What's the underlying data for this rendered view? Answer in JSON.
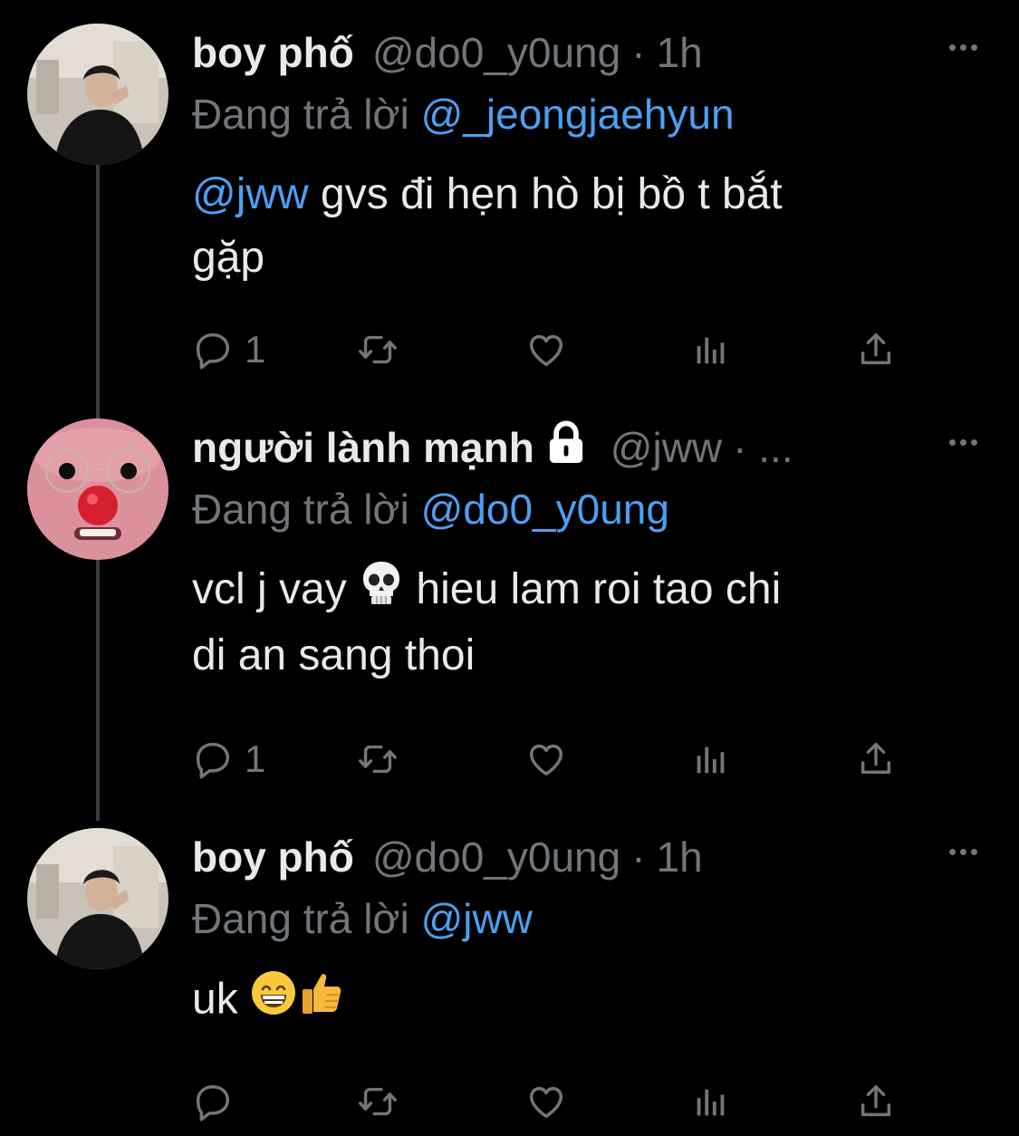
{
  "tweets": [
    {
      "name": "boy phố",
      "handle": "@do0_y0ung",
      "dot": "·",
      "time": "1h",
      "reply_prefix": "Đang trả lời",
      "reply_to": "@_jeongjaehyun",
      "mention": "@jww",
      "text_line1": " gvs đi hẹn hò bị bồ t bắt",
      "text_line2": "gặp",
      "reply_count": "1"
    },
    {
      "name": "người lành mạnh",
      "handle": "@jww",
      "time": "· ...",
      "reply_prefix": "Đang trả lời",
      "reply_to": "@do0_y0ung",
      "text_part1": "vcl j vay",
      "text_part2": " hieu lam roi tao chi",
      "text_line2": "di an sang thoi",
      "reply_count": "1"
    },
    {
      "name": "boy phố",
      "handle": "@do0_y0ung",
      "dot": "·",
      "time": "1h",
      "reply_prefix": "Đang trả lời",
      "reply_to": "@jww",
      "text": "uk"
    }
  ],
  "icons": [
    "reply-icon",
    "retweet-icon",
    "like-icon",
    "analytics-icon",
    "share-icon",
    "more-icon",
    "lock-icon",
    "skull-emoji",
    "grin-emoji",
    "thumbs-up-emoji"
  ],
  "colors": {
    "background": "#000000",
    "text": "#e7e9ea",
    "muted": "#71767b",
    "link": "#4d9ff0",
    "thread_line": "#3a3d41"
  }
}
